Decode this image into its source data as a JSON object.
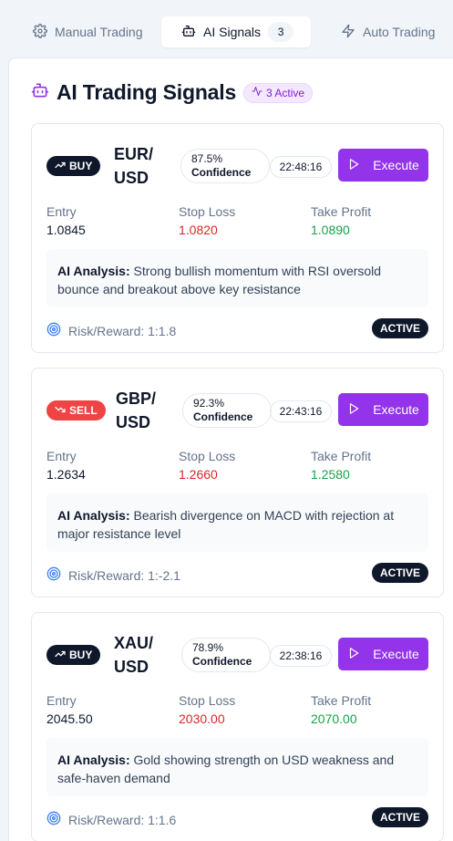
{
  "tabs": [
    {
      "label": "Manual Trading",
      "icon": "gear-icon"
    },
    {
      "label": "AI Signals",
      "icon": "bot-icon",
      "badge": "3"
    },
    {
      "label": "Auto Trading",
      "icon": "zap-icon"
    }
  ],
  "panel": {
    "title": "AI Trading Signals",
    "active_pill": "3 Active"
  },
  "labels": {
    "entry": "Entry",
    "stop_loss": "Stop Loss",
    "take_profit": "Take Profit",
    "analysis_prefix": "AI Analysis:",
    "execute": "Execute",
    "confidence": "Confidence"
  },
  "signals": [
    {
      "side": "BUY",
      "pair_line1": "EUR/",
      "pair_line2": "USD",
      "confidence": "87.5%",
      "time": "22:48:16",
      "entry": "1.0845",
      "stop_loss": "1.0820",
      "take_profit": "1.0890",
      "analysis": "Strong bullish momentum with RSI oversold bounce and breakout above key resistance",
      "risk_reward": "Risk/Reward: 1:1.8",
      "status": "ACTIVE"
    },
    {
      "side": "SELL",
      "pair_line1": "GBP/",
      "pair_line2": "USD",
      "confidence": "92.3%",
      "time": "22:43:16",
      "entry": "1.2634",
      "stop_loss": "1.2660",
      "take_profit": "1.2580",
      "analysis": "Bearish divergence on MACD with rejection at major resistance level",
      "risk_reward": "Risk/Reward: 1:-2.1",
      "status": "ACTIVE"
    },
    {
      "side": "BUY",
      "pair_line1": "XAU/",
      "pair_line2": "USD",
      "confidence": "78.9%",
      "time": "22:38:16",
      "entry": "2045.50",
      "stop_loss": "2030.00",
      "take_profit": "2070.00",
      "analysis": "Gold showing strength on USD weakness and safe-haven demand",
      "risk_reward": "Risk/Reward: 1:1.6",
      "status": "ACTIVE"
    }
  ],
  "colors": {
    "accent": "#9333ea",
    "buy_badge": "#0f172a",
    "sell_badge": "#ef4444",
    "stop_loss": "#dc2626",
    "take_profit": "#16a34a"
  }
}
